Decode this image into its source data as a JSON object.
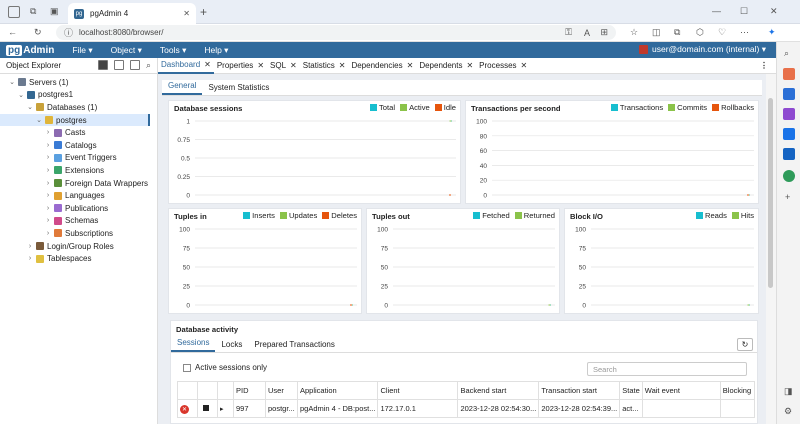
{
  "browser": {
    "tab_title": "pgAdmin 4",
    "url": "localhost:8080/browser/",
    "new_tab": "+",
    "close": "✕"
  },
  "menubar": {
    "logo_pg": "pg",
    "logo_rest": "Admin",
    "items": [
      "File ▾",
      "Object ▾",
      "Tools ▾",
      "Help ▾"
    ],
    "user": "user@domain.com (internal) ▾"
  },
  "object_explorer": {
    "title": "Object Explorer",
    "tree": [
      {
        "label": "Servers (1)",
        "level": 0,
        "caret": "⌄",
        "icon": "servers-icon",
        "color": "#6b7a8f"
      },
      {
        "label": "postgres1",
        "level": 1,
        "caret": "⌄",
        "icon": "server-icon",
        "color": "#336791"
      },
      {
        "label": "Databases (1)",
        "level": 2,
        "caret": "⌄",
        "icon": "databases-icon",
        "color": "#c9a23a"
      },
      {
        "label": "postgres",
        "level": 3,
        "caret": "⌄",
        "icon": "database-icon",
        "color": "#e0b53a",
        "selected": true
      },
      {
        "label": "Casts",
        "level": 4,
        "caret": "›",
        "icon": "casts-icon",
        "color": "#8c6bb1"
      },
      {
        "label": "Catalogs",
        "level": 4,
        "caret": "›",
        "icon": "catalogs-icon",
        "color": "#3a7bd5"
      },
      {
        "label": "Event Triggers",
        "level": 4,
        "caret": "›",
        "icon": "event-triggers-icon",
        "color": "#5aa0e0"
      },
      {
        "label": "Extensions",
        "level": 4,
        "caret": "›",
        "icon": "extensions-icon",
        "color": "#3aa56a"
      },
      {
        "label": "Foreign Data Wrappers",
        "level": 4,
        "caret": "›",
        "icon": "fdw-icon",
        "color": "#5a8f3a"
      },
      {
        "label": "Languages",
        "level": 4,
        "caret": "›",
        "icon": "languages-icon",
        "color": "#e0a030"
      },
      {
        "label": "Publications",
        "level": 4,
        "caret": "›",
        "icon": "publications-icon",
        "color": "#9a6bd0"
      },
      {
        "label": "Schemas",
        "level": 4,
        "caret": "›",
        "icon": "schemas-icon",
        "color": "#d04a8a"
      },
      {
        "label": "Subscriptions",
        "level": 4,
        "caret": "›",
        "icon": "subscriptions-icon",
        "color": "#e07a3a"
      },
      {
        "label": "Login/Group Roles",
        "level": 2,
        "caret": "›",
        "icon": "roles-icon",
        "color": "#7a5a3a"
      },
      {
        "label": "Tablespaces",
        "level": 2,
        "caret": "›",
        "icon": "tablespaces-icon",
        "color": "#e0c040"
      }
    ]
  },
  "main_tabs": [
    {
      "label": "Dashboard",
      "active": true
    },
    {
      "label": "Properties"
    },
    {
      "label": "SQL"
    },
    {
      "label": "Statistics"
    },
    {
      "label": "Dependencies"
    },
    {
      "label": "Dependents"
    },
    {
      "label": "Processes"
    }
  ],
  "sub_tabs": [
    "General",
    "System Statistics"
  ],
  "colors": {
    "teal": "#17becf",
    "green": "#8bc34a",
    "orange": "#e6550d"
  },
  "panels": {
    "sessions": {
      "title": "Database sessions",
      "legend": [
        "Total",
        "Active",
        "Idle"
      ]
    },
    "tps": {
      "title": "Transactions per second",
      "legend": [
        "Transactions",
        "Commits",
        "Rollbacks"
      ]
    },
    "tuples_in": {
      "title": "Tuples in",
      "legend": [
        "Inserts",
        "Updates",
        "Deletes"
      ]
    },
    "tuples_out": {
      "title": "Tuples out",
      "legend": [
        "Fetched",
        "Returned"
      ]
    },
    "block_io": {
      "title": "Block I/O",
      "legend": [
        "Reads",
        "Hits"
      ]
    }
  },
  "chart_data": [
    {
      "type": "line",
      "title": "Database sessions",
      "yticks": [
        "1",
        "0.75",
        "0.5",
        "0.25",
        "0"
      ],
      "ylim": [
        0,
        1
      ],
      "series": [
        {
          "name": "Total",
          "values": [
            1
          ]
        },
        {
          "name": "Active",
          "values": [
            1
          ]
        },
        {
          "name": "Idle",
          "values": [
            0
          ]
        }
      ]
    },
    {
      "type": "line",
      "title": "Transactions per second",
      "yticks": [
        "100",
        "80",
        "60",
        "40",
        "20",
        "0"
      ],
      "ylim": [
        0,
        100
      ],
      "series": [
        {
          "name": "Transactions",
          "values": [
            0
          ]
        },
        {
          "name": "Commits",
          "values": [
            0
          ]
        },
        {
          "name": "Rollbacks",
          "values": [
            0
          ]
        }
      ]
    },
    {
      "type": "line",
      "title": "Tuples in",
      "yticks": [
        "100",
        "75",
        "50",
        "25",
        "0"
      ],
      "ylim": [
        0,
        100
      ],
      "series": [
        {
          "name": "Inserts",
          "values": [
            0
          ]
        },
        {
          "name": "Updates",
          "values": [
            0
          ]
        },
        {
          "name": "Deletes",
          "values": [
            0
          ]
        }
      ]
    },
    {
      "type": "line",
      "title": "Tuples out",
      "yticks": [
        "100",
        "75",
        "50",
        "25",
        "0"
      ],
      "ylim": [
        0,
        100
      ],
      "series": [
        {
          "name": "Fetched",
          "values": [
            0
          ]
        },
        {
          "name": "Returned",
          "values": [
            0
          ]
        }
      ]
    },
    {
      "type": "line",
      "title": "Block I/O",
      "yticks": [
        "100",
        "75",
        "50",
        "25",
        "0"
      ],
      "ylim": [
        0,
        100
      ],
      "series": [
        {
          "name": "Reads",
          "values": [
            0
          ]
        },
        {
          "name": "Hits",
          "values": [
            0
          ]
        }
      ]
    }
  ],
  "activity": {
    "title": "Database activity",
    "tabs": [
      "Sessions",
      "Locks",
      "Prepared Transactions"
    ],
    "checkbox_label": "Active sessions only",
    "search_placeholder": "Search",
    "columns": [
      "",
      "",
      "",
      "PID",
      "User",
      "Application",
      "Client",
      "Backend start",
      "Transaction start",
      "State",
      "Wait event",
      "Blocking"
    ],
    "rows": [
      {
        "pid": "997",
        "user": "postgr...",
        "application": "pgAdmin 4 - DB:post...",
        "client": "172.17.0.1",
        "backend_start": "2023-12-28 02:54:30...",
        "transaction_start": "2023-12-28 02:54:39...",
        "state": "act...",
        "wait_event": "",
        "blocking": ""
      }
    ]
  }
}
